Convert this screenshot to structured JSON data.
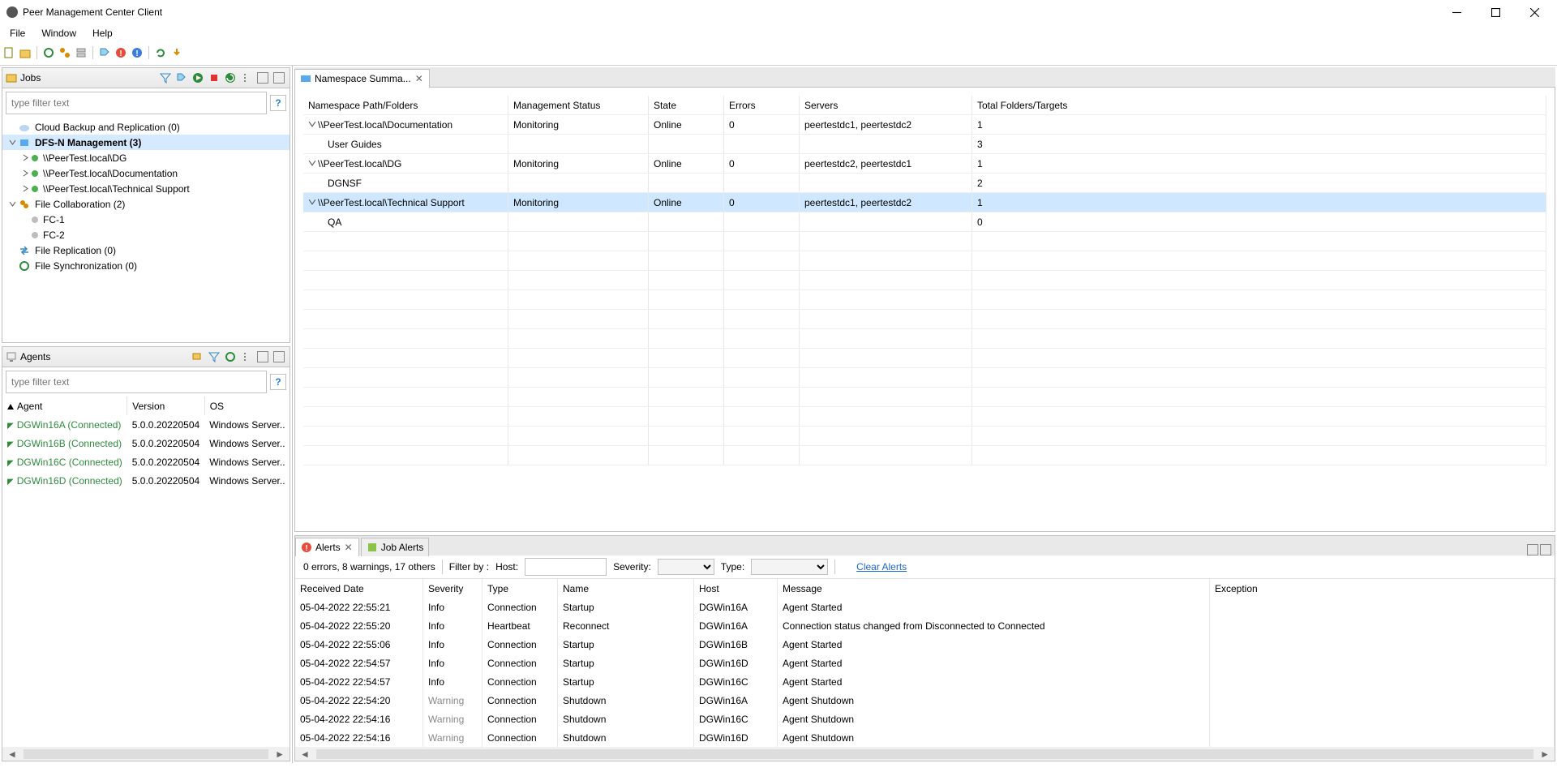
{
  "window": {
    "title": "Peer Management Center Client"
  },
  "menu": [
    "File",
    "Window",
    "Help"
  ],
  "jobs_view": {
    "title": "Jobs",
    "filter_placeholder": "type filter text",
    "tree": [
      {
        "label": "Cloud Backup and Replication (0)",
        "icon": "cloud",
        "depth": 0
      },
      {
        "label": "DFS-N Management (3)",
        "icon": "dfsn",
        "depth": 0,
        "expand": "open",
        "selected": true
      },
      {
        "label": "\\\\PeerTest.local\\DG",
        "icon": "green",
        "depth": 1,
        "expand": "closed"
      },
      {
        "label": "\\\\PeerTest.local\\Documentation",
        "icon": "green",
        "depth": 1,
        "expand": "closed"
      },
      {
        "label": "\\\\PeerTest.local\\Technical Support",
        "icon": "green",
        "depth": 1,
        "expand": "closed"
      },
      {
        "label": "File Collaboration (2)",
        "icon": "collab",
        "depth": 0,
        "expand": "open"
      },
      {
        "label": "FC-1",
        "icon": "gray",
        "depth": 1
      },
      {
        "label": "FC-2",
        "icon": "gray",
        "depth": 1
      },
      {
        "label": "File Replication (0)",
        "icon": "repl",
        "depth": 0
      },
      {
        "label": "File Synchronization (0)",
        "icon": "sync",
        "depth": 0
      }
    ]
  },
  "agents_view": {
    "title": "Agents",
    "filter_placeholder": "type filter text",
    "columns": [
      "Agent",
      "Version",
      "OS"
    ],
    "rows": [
      {
        "agent": "DGWin16A (Connected)",
        "version": "5.0.0.20220504",
        "os": "Windows Server.."
      },
      {
        "agent": "DGWin16B (Connected)",
        "version": "5.0.0.20220504",
        "os": "Windows Server.."
      },
      {
        "agent": "DGWin16C (Connected)",
        "version": "5.0.0.20220504",
        "os": "Windows Server.."
      },
      {
        "agent": "DGWin16D (Connected)",
        "version": "5.0.0.20220504",
        "os": "Windows Server.."
      }
    ]
  },
  "editor_tab": "Namespace Summa...",
  "ns_table": {
    "columns": [
      "Namespace Path/Folders",
      "Management Status",
      "State",
      "Errors",
      "Servers",
      "Total Folders/Targets"
    ],
    "rows": [
      {
        "exp": "open",
        "path": "\\\\PeerTest.local\\Documentation",
        "status": "Monitoring",
        "state": "Online",
        "errors": "0",
        "servers": "peertestdc1, peertestdc2",
        "total": "1"
      },
      {
        "indent": true,
        "path": "User Guides",
        "total": "3"
      },
      {
        "exp": "open",
        "path": "\\\\PeerTest.local\\DG",
        "status": "Monitoring",
        "state": "Online",
        "errors": "0",
        "servers": "peertestdc2, peertestdc1",
        "total": "1"
      },
      {
        "indent": true,
        "path": "DGNSF",
        "total": "2"
      },
      {
        "exp": "open",
        "path": "\\\\PeerTest.local\\Technical Support",
        "status": "Monitoring",
        "state": "Online",
        "errors": "0",
        "servers": "peertestdc1, peertestdc2",
        "total": "1",
        "selected": true
      },
      {
        "indent": true,
        "path": "QA",
        "total": "0"
      }
    ]
  },
  "alerts_tabs": {
    "alerts": "Alerts",
    "job_alerts": "Job Alerts"
  },
  "alerts_bar": {
    "summary": "0 errors, 8 warnings, 17 others",
    "filter_by": "Filter by :",
    "host": "Host:",
    "severity": "Severity:",
    "type": "Type:",
    "clear": "Clear Alerts"
  },
  "alerts_table": {
    "columns": [
      "Received Date",
      "Severity",
      "Type",
      "Name",
      "Host",
      "Message",
      "Exception"
    ],
    "rows": [
      {
        "date": "05-04-2022 22:55:21",
        "sev": "Info",
        "type": "Connection",
        "name": "Startup",
        "host": "DGWin16A",
        "msg": "Agent Started"
      },
      {
        "date": "05-04-2022 22:55:20",
        "sev": "Info",
        "type": "Heartbeat",
        "name": "Reconnect",
        "host": "DGWin16A",
        "msg": "Connection status changed from Disconnected to Connected"
      },
      {
        "date": "05-04-2022 22:55:06",
        "sev": "Info",
        "type": "Connection",
        "name": "Startup",
        "host": "DGWin16B",
        "msg": "Agent Started"
      },
      {
        "date": "05-04-2022 22:54:57",
        "sev": "Info",
        "type": "Connection",
        "name": "Startup",
        "host": "DGWin16D",
        "msg": "Agent Started"
      },
      {
        "date": "05-04-2022 22:54:57",
        "sev": "Info",
        "type": "Connection",
        "name": "Startup",
        "host": "DGWin16C",
        "msg": "Agent Started"
      },
      {
        "date": "05-04-2022 22:54:20",
        "sev": "Warning",
        "type": "Connection",
        "name": "Shutdown",
        "host": "DGWin16A",
        "msg": "Agent Shutdown"
      },
      {
        "date": "05-04-2022 22:54:16",
        "sev": "Warning",
        "type": "Connection",
        "name": "Shutdown",
        "host": "DGWin16C",
        "msg": "Agent Shutdown"
      },
      {
        "date": "05-04-2022 22:54:16",
        "sev": "Warning",
        "type": "Connection",
        "name": "Shutdown",
        "host": "DGWin16D",
        "msg": "Agent Shutdown"
      }
    ]
  }
}
